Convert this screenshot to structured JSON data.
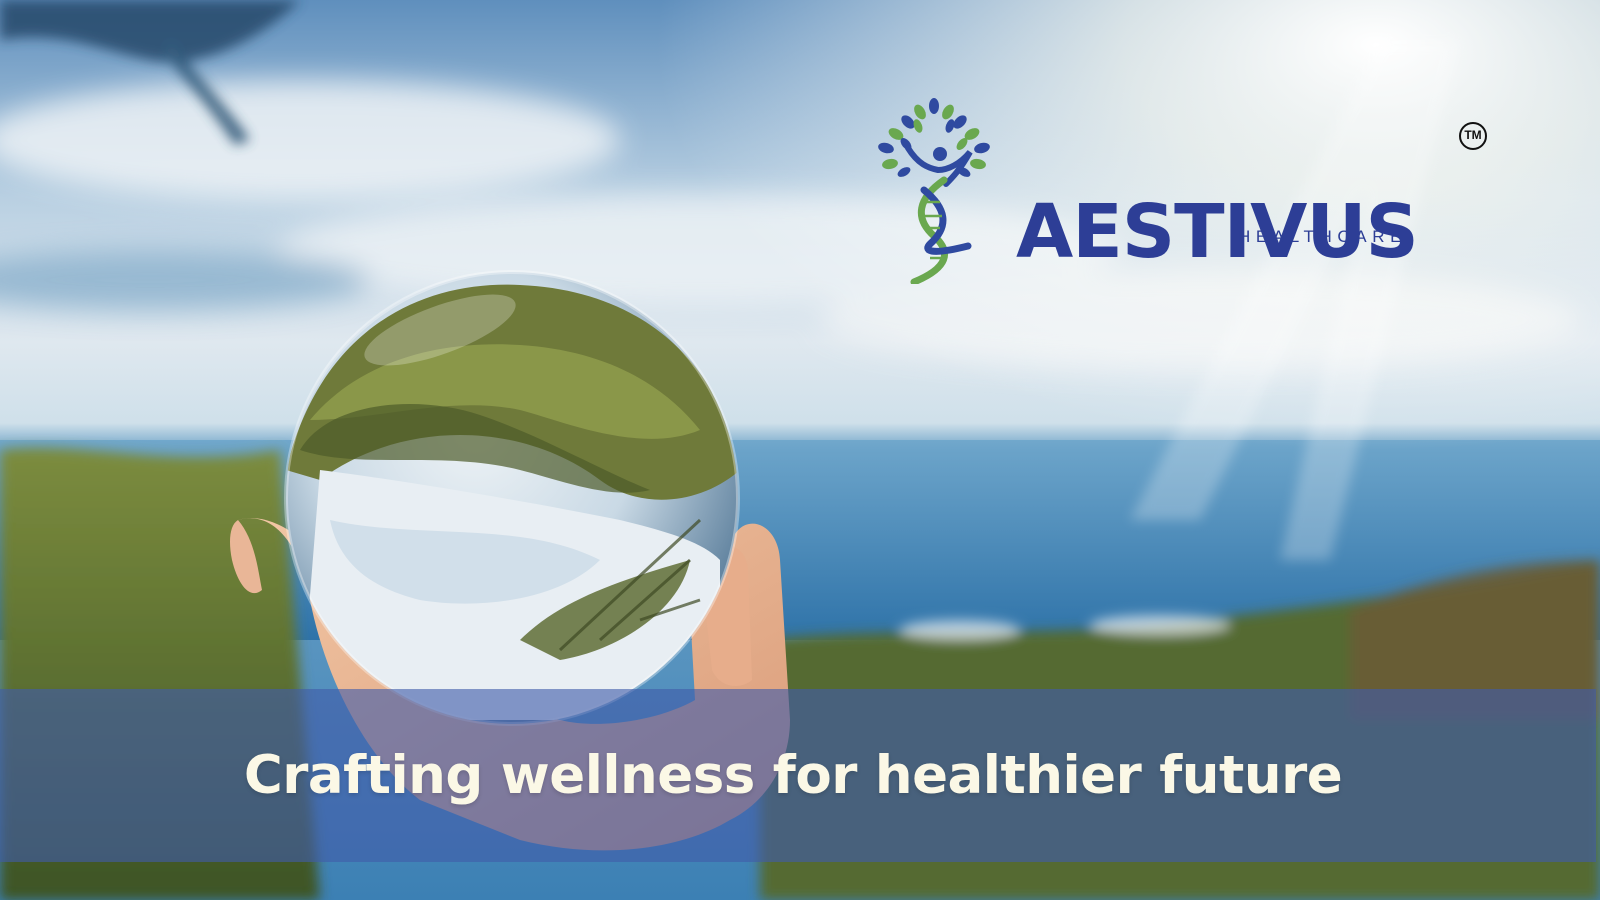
{
  "brand": {
    "name": "AESTIVUS",
    "subtitle": "HEALTHCARE",
    "trademark": "TM",
    "logo_icon": "dna-tree-figure-icon",
    "color": "#2d3e96",
    "leaf_colors": [
      "#2f4aa0",
      "#6aa84f"
    ]
  },
  "hero": {
    "tagline": "Crafting wellness for healthier future",
    "band_color": "#405caa",
    "tagline_color": "#fbf8e6",
    "photo_subject": "hand holding glass ball reflecting hillside and sea"
  }
}
